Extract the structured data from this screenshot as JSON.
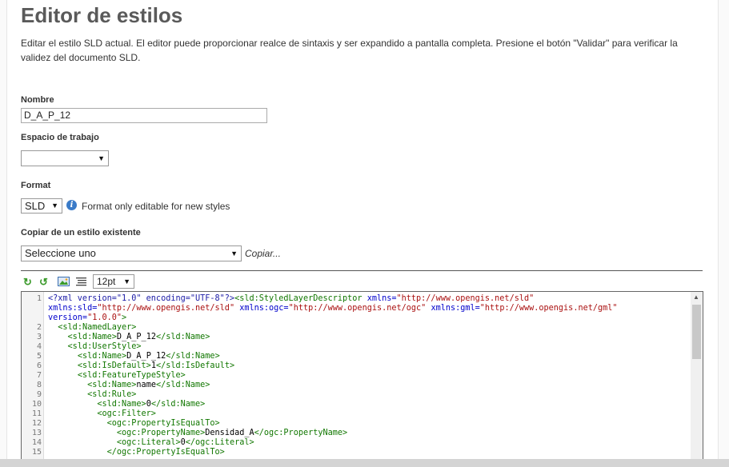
{
  "header": {
    "title": "Editor de estilos",
    "description": "Editar el estilo SLD actual. El editor puede proporcionar realce de sintaxis y ser expandido a pantalla completa. Presione el botón \"Validar\" para verificar la validez del documento SLD."
  },
  "form": {
    "name_label": "Nombre",
    "name_value": "D_A_P_12",
    "workspace_label": "Espacio de trabajo",
    "workspace_value": "",
    "format_label": "Format",
    "format_value": "SLD",
    "format_note": "Format only editable for new styles",
    "copy_label": "Copiar de un estilo existente",
    "copy_select_value": "Seleccione uno",
    "copy_link": "Copiar..."
  },
  "toolbar": {
    "undo_icon": "undo-icon",
    "redo_icon": "redo-icon",
    "image_icon": "image-icon",
    "format_icon": "format-lines-icon",
    "font_size": "12pt"
  },
  "editor": {
    "lines": [
      {
        "n": "1",
        "parts": [
          [
            "pi",
            "<?xml version=\"1.0\" encoding=\"UTF-8\"?>"
          ],
          [
            "tag",
            "<sld:StyledLayerDescriptor "
          ],
          [
            "attr",
            "xmlns="
          ],
          [
            "str",
            "\"http://www.opengis.net/sld\""
          ]
        ]
      },
      {
        "n": "",
        "parts": [
          [
            "attr",
            "xmlns:sld="
          ],
          [
            "str",
            "\"http://www.opengis.net/sld\" "
          ],
          [
            "attr",
            "xmlns:ogc="
          ],
          [
            "str",
            "\"http://www.opengis.net/ogc\" "
          ],
          [
            "attr",
            "xmlns:gml="
          ],
          [
            "str",
            "\"http://www.opengis.net/gml\""
          ]
        ]
      },
      {
        "n": "",
        "parts": [
          [
            "attr",
            "version="
          ],
          [
            "str",
            "\"1.0.0\""
          ],
          [
            "tag",
            ">"
          ]
        ]
      },
      {
        "n": "2",
        "parts": [
          [
            "txt",
            "  "
          ],
          [
            "tag",
            "<sld:NamedLayer>"
          ]
        ]
      },
      {
        "n": "3",
        "parts": [
          [
            "txt",
            "    "
          ],
          [
            "tag",
            "<sld:Name>"
          ],
          [
            "txt",
            "D_A_P_12"
          ],
          [
            "tag",
            "</sld:Name>"
          ]
        ]
      },
      {
        "n": "4",
        "parts": [
          [
            "txt",
            "    "
          ],
          [
            "tag",
            "<sld:UserStyle>"
          ]
        ]
      },
      {
        "n": "5",
        "parts": [
          [
            "txt",
            "      "
          ],
          [
            "tag",
            "<sld:Name>"
          ],
          [
            "txt",
            "D_A_P_12"
          ],
          [
            "tag",
            "</sld:Name>"
          ]
        ]
      },
      {
        "n": "6",
        "parts": [
          [
            "txt",
            "      "
          ],
          [
            "tag",
            "<sld:IsDefault>"
          ],
          [
            "txt",
            "1"
          ],
          [
            "tag",
            "</sld:IsDefault>"
          ]
        ]
      },
      {
        "n": "7",
        "parts": [
          [
            "txt",
            "      "
          ],
          [
            "tag",
            "<sld:FeatureTypeStyle>"
          ]
        ]
      },
      {
        "n": "8",
        "parts": [
          [
            "txt",
            "        "
          ],
          [
            "tag",
            "<sld:Name>"
          ],
          [
            "txt",
            "name"
          ],
          [
            "tag",
            "</sld:Name>"
          ]
        ]
      },
      {
        "n": "9",
        "parts": [
          [
            "txt",
            "        "
          ],
          [
            "tag",
            "<sld:Rule>"
          ]
        ]
      },
      {
        "n": "10",
        "parts": [
          [
            "txt",
            "          "
          ],
          [
            "tag",
            "<sld:Name>"
          ],
          [
            "txt",
            "0"
          ],
          [
            "tag",
            "</sld:Name>"
          ]
        ]
      },
      {
        "n": "11",
        "parts": [
          [
            "txt",
            "          "
          ],
          [
            "tag",
            "<ogc:Filter>"
          ]
        ]
      },
      {
        "n": "12",
        "parts": [
          [
            "txt",
            "            "
          ],
          [
            "tag",
            "<ogc:PropertyIsEqualTo>"
          ]
        ]
      },
      {
        "n": "13",
        "parts": [
          [
            "txt",
            "              "
          ],
          [
            "tag",
            "<ogc:PropertyName>"
          ],
          [
            "txt",
            "Densidad_A"
          ],
          [
            "tag",
            "</ogc:PropertyName>"
          ]
        ]
      },
      {
        "n": "14",
        "parts": [
          [
            "txt",
            "              "
          ],
          [
            "tag",
            "<ogc:Literal>"
          ],
          [
            "txt",
            "0"
          ],
          [
            "tag",
            "</ogc:Literal>"
          ]
        ]
      },
      {
        "n": "15",
        "parts": [
          [
            "txt",
            "            "
          ],
          [
            "tag",
            "</ogc:PropertyIsEqualTo>"
          ]
        ]
      }
    ]
  }
}
